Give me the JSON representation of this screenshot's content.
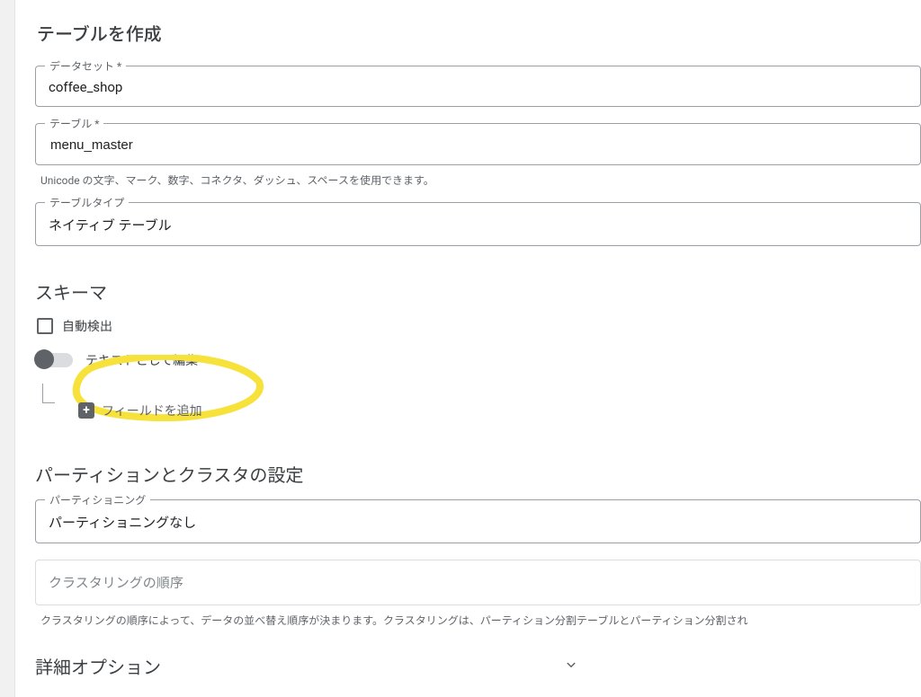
{
  "page": {
    "title": "テーブルを作成"
  },
  "dataset": {
    "label": "データセット *",
    "value": "coffee_shop"
  },
  "table": {
    "label": "テーブル *",
    "value": "menu_master",
    "helper": "Unicode の文字、マーク、数字、コネクタ、ダッシュ、スペースを使用できます。"
  },
  "tableType": {
    "label": "テーブルタイプ",
    "value": "ネイティブ テーブル"
  },
  "schema": {
    "heading": "スキーマ",
    "autoDetect": "自動検出",
    "editAsText": "テキストとして編集",
    "addField": "フィールドを追加"
  },
  "partition": {
    "heading": "パーティションとクラスタの設定",
    "label": "パーティショニング",
    "value": "パーティショニングなし"
  },
  "clustering": {
    "placeholder": "クラスタリングの順序",
    "helper": "クラスタリングの順序によって、データの並べ替え順序が決まります。クラスタリングは、パーティション分割テーブルとパーティション分割され"
  },
  "advanced": {
    "label": "詳細オプション"
  },
  "stray": {
    "s1": "﻿",
    "s2": "﻿"
  }
}
